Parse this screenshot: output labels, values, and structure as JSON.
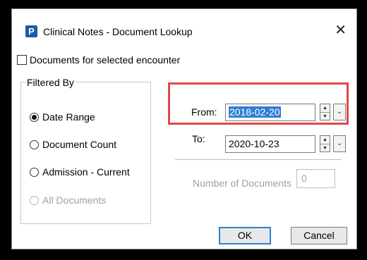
{
  "window": {
    "app_icon_letter": "P",
    "title": "Clinical Notes - Document Lookup",
    "close_glyph": "✕"
  },
  "filter": {
    "encounter_checkbox_label": "Documents for selected encounter",
    "encounter_checked": false,
    "group_label": "Filtered By",
    "options": [
      {
        "label": "Date Range",
        "selected": true,
        "enabled": true
      },
      {
        "label": "Document Count",
        "selected": false,
        "enabled": true
      },
      {
        "label": "Admission - Current",
        "selected": false,
        "enabled": true
      },
      {
        "label": "All Documents",
        "selected": false,
        "enabled": false
      }
    ]
  },
  "dates": {
    "from_label": "From:",
    "from_value": "2018-02-20",
    "to_label": "To:",
    "to_value": "2020-10-23"
  },
  "count": {
    "label": "Number of Documents",
    "value": "0"
  },
  "buttons": {
    "ok": "OK",
    "cancel": "Cancel"
  },
  "colors": {
    "highlight": "#e04848",
    "selection": "#2f7fd6"
  },
  "icons": {
    "spin_up": "▲",
    "spin_down": "▼",
    "dropdown": "⌄"
  }
}
